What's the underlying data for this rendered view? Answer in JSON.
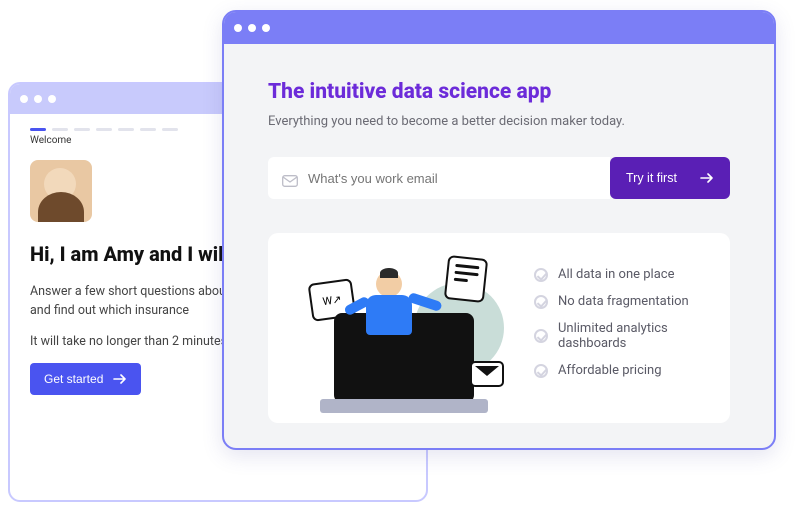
{
  "back_window": {
    "step_label": "Welcome",
    "headline": "Hi, I am Amy and I will walk Check",
    "para1": "Answer a few short questions about your current individual risks and find out which insurance",
    "para2": "It will take no longer than 2 minutes.",
    "cta_label": "Get started"
  },
  "front_window": {
    "hero_title": "The intuitive data science app",
    "hero_sub": "Everything you need to become a better decision maker today.",
    "email_placeholder": "What's you work email",
    "cta_label": "Try it first",
    "illustration_chart_glyph": "W↗",
    "features": [
      "All data in one place",
      "No data fragmentation",
      "Unlimited analytics dashboards",
      "Affordable pricing"
    ]
  },
  "colors": {
    "front_border": "#7b7ef6",
    "back_border": "#c8c9ff",
    "accent_purple": "#6c2bd9",
    "cta_purple": "#5a1fb5",
    "cta_blue": "#4a54f0"
  }
}
